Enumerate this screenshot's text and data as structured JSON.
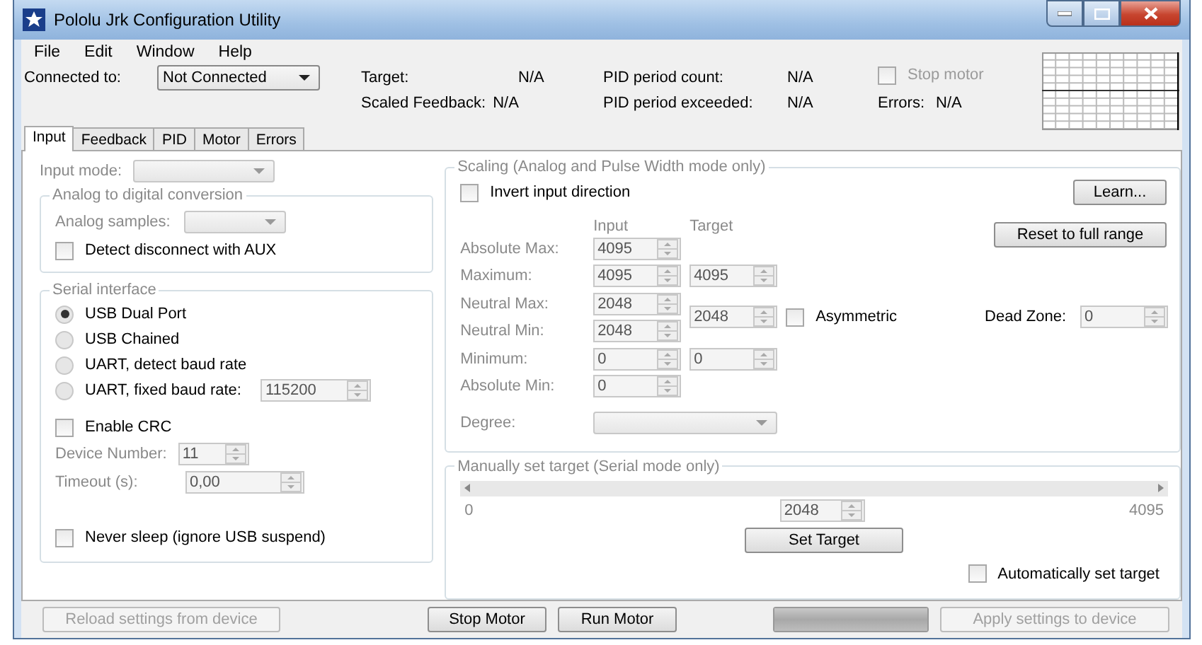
{
  "window": {
    "title": "Pololu Jrk Configuration Utility"
  },
  "menu": [
    {
      "label": "File"
    },
    {
      "label": "Edit"
    },
    {
      "label": "Window"
    },
    {
      "label": "Help"
    }
  ],
  "connection": {
    "label": "Connected to:",
    "value": "Not Connected"
  },
  "status": [
    {
      "label": "Target:",
      "value": "N/A"
    },
    {
      "label": "Scaled Feedback:",
      "value": "N/A"
    },
    {
      "label": "PID period count:",
      "value": "N/A"
    },
    {
      "label": "PID period exceeded:",
      "value": "N/A"
    }
  ],
  "stop_motor": {
    "label": "Stop motor",
    "checked": false,
    "disabled": true
  },
  "errors": {
    "label": "Errors:",
    "value": "N/A"
  },
  "tabs": [
    {
      "label": "Input",
      "selected": true
    },
    {
      "label": "Feedback",
      "selected": false
    },
    {
      "label": "PID",
      "selected": false
    },
    {
      "label": "Motor",
      "selected": false
    },
    {
      "label": "Errors",
      "selected": false
    }
  ],
  "input_mode": {
    "label": "Input mode:"
  },
  "adc": {
    "title": "Analog to digital conversion",
    "samples_label": "Analog samples:",
    "detect": {
      "label": "Detect disconnect with AUX",
      "checked": false
    }
  },
  "serial": {
    "title": "Serial interface",
    "modes": [
      {
        "label": "USB Dual Port",
        "selected": true
      },
      {
        "label": "USB Chained",
        "selected": false
      },
      {
        "label": "UART, detect baud rate",
        "selected": false
      },
      {
        "label": "UART, fixed baud rate:",
        "selected": false
      }
    ],
    "baud": "115200",
    "crc": {
      "label": "Enable CRC",
      "checked": false
    },
    "device_number": {
      "label": "Device Number:",
      "value": "11"
    },
    "timeout": {
      "label": "Timeout (s):",
      "value": "0,00"
    },
    "never_sleep": {
      "label": "Never sleep (ignore USB suspend)",
      "checked": false
    }
  },
  "scaling": {
    "title": "Scaling (Analog and Pulse Width mode only)",
    "invert": {
      "label": "Invert input direction",
      "checked": false
    },
    "learn": "Learn...",
    "reset": "Reset to full range",
    "col_input": "Input",
    "col_target": "Target",
    "rows": [
      {
        "label": "Absolute Max:",
        "input": "4095"
      },
      {
        "label": "Maximum:",
        "input": "4095",
        "target": "4095"
      },
      {
        "label": "Neutral Max:",
        "input": "2048"
      },
      {
        "label": "Neutral Min:",
        "input": "2048"
      },
      {
        "label": "Minimum:",
        "input": "0",
        "target": "0"
      },
      {
        "label": "Absolute Min:",
        "input": "0"
      }
    ],
    "neutral_target": "2048",
    "asymmetric": {
      "label": "Asymmetric",
      "checked": false
    },
    "dead_zone": {
      "label": "Dead Zone:",
      "value": "0"
    },
    "degree_label": "Degree:"
  },
  "manual": {
    "title": "Manually set target (Serial mode only)",
    "min": "0",
    "max": "4095",
    "value": "2048",
    "set_button": "Set Target",
    "auto": {
      "label": "Automatically set target",
      "checked": false
    }
  },
  "buttons": [
    {
      "label": "Reload settings from device",
      "kind": "button",
      "disabled": true
    },
    {
      "label": "Stop Motor",
      "kind": "button",
      "disabled": false
    },
    {
      "label": "Run Motor",
      "kind": "button",
      "disabled": false
    },
    {
      "kind": "progress",
      "level": 1
    },
    {
      "label": "Apply settings to device",
      "kind": "button",
      "disabled": true
    }
  ]
}
